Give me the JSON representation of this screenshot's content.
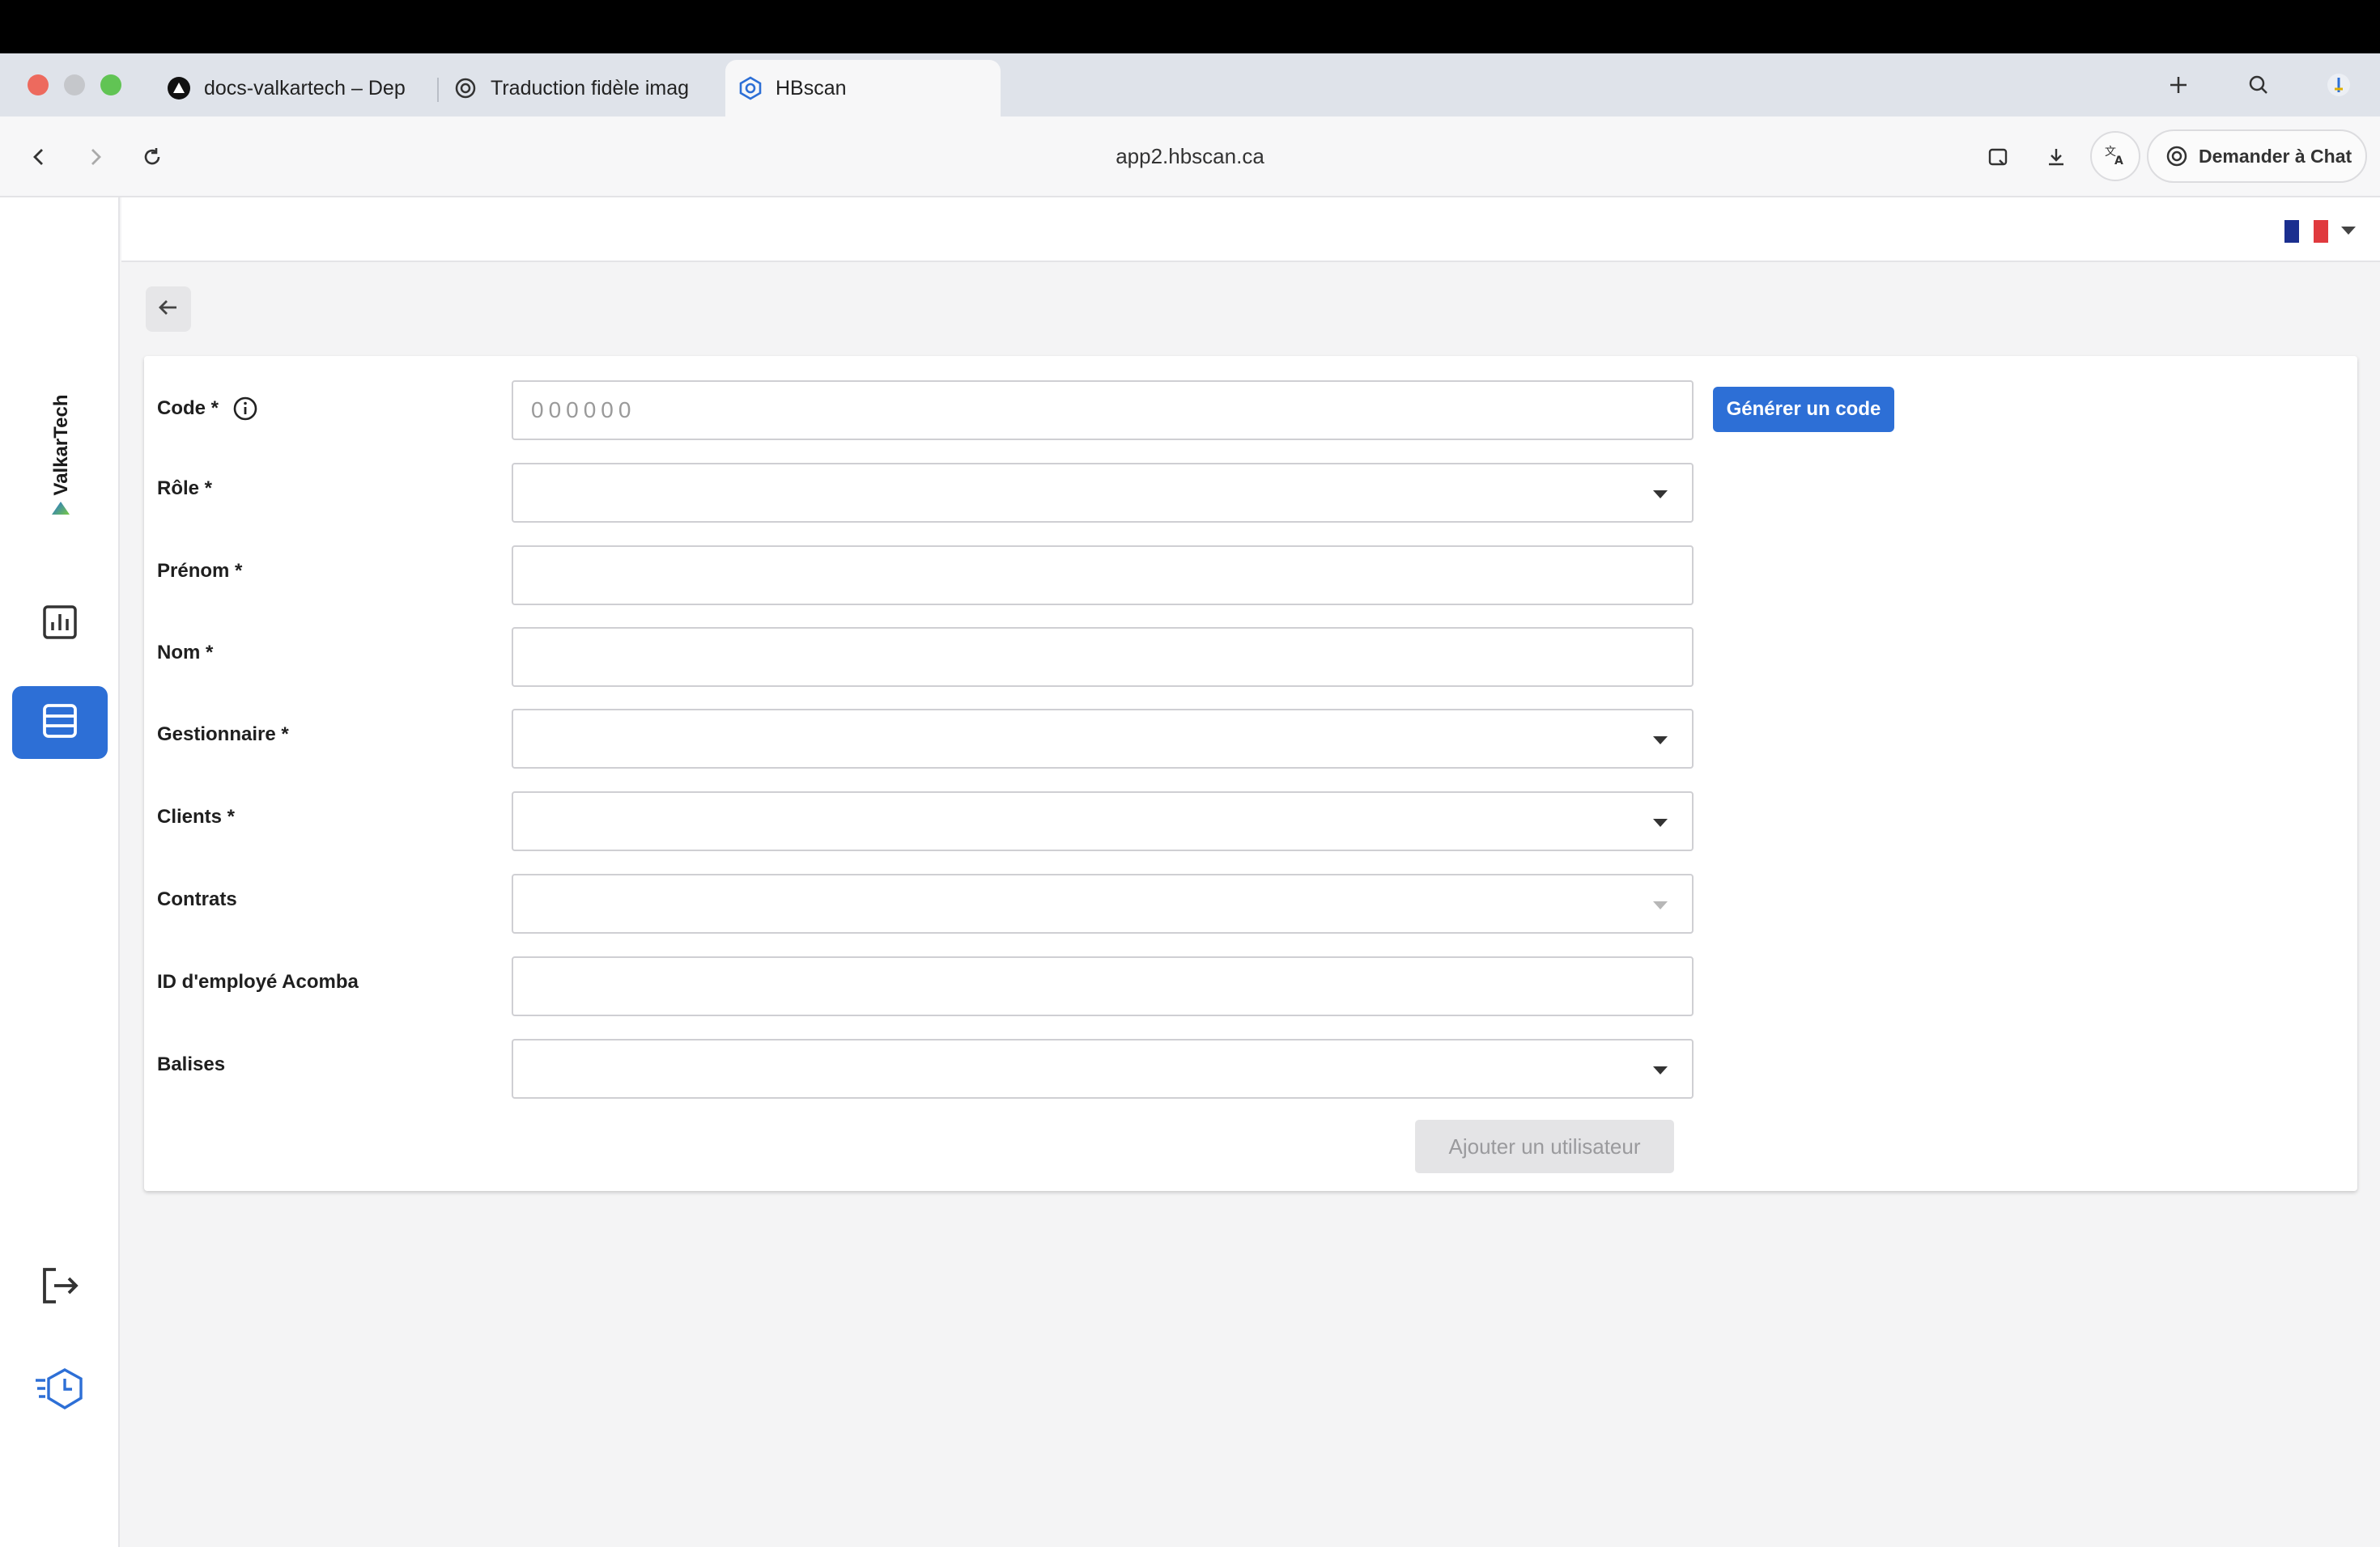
{
  "browser": {
    "tabs": [
      {
        "title": "docs-valkartech – Dep",
        "icon": "vercel-triangle-icon"
      },
      {
        "title": "Traduction fidèle imag",
        "icon": "openai-icon"
      },
      {
        "title": "HBscan",
        "icon": "hbscan-logo-icon"
      }
    ],
    "url": "app2.hbscan.ca",
    "chat_button_label": "Demander à Chat"
  },
  "sidebar": {
    "brand": "ValkarTech",
    "items": [
      {
        "name": "dashboard",
        "icon": "bar-chart-icon"
      },
      {
        "name": "list",
        "icon": "list-icon",
        "active": true
      },
      {
        "name": "logout",
        "icon": "logout-icon"
      },
      {
        "name": "timesheet",
        "icon": "clock-hexagon-icon"
      }
    ]
  },
  "header": {
    "language": "FR",
    "flag_colors": [
      "#1b2f8f",
      "#ffffff",
      "#e03a3e"
    ]
  },
  "form": {
    "fields": [
      {
        "label": "Code *",
        "type": "text",
        "placeholder": "000000",
        "value": ""
      },
      {
        "label": "Rôle *",
        "type": "select",
        "value": ""
      },
      {
        "label": "Prénom *",
        "type": "text",
        "value": ""
      },
      {
        "label": "Nom *",
        "type": "text",
        "value": ""
      },
      {
        "label": "Gestionnaire *",
        "type": "select",
        "value": ""
      },
      {
        "label": "Clients *",
        "type": "select",
        "value": ""
      },
      {
        "label": "Contrats",
        "type": "select",
        "disabled": true,
        "value": ""
      },
      {
        "label": "ID d'employé Acomba",
        "type": "text",
        "value": ""
      },
      {
        "label": "Balises",
        "type": "select",
        "value": ""
      }
    ],
    "generate_button": "Générer un code",
    "submit_button": "Ajouter un utilisateur"
  },
  "colors": {
    "accent": "#2d6fd6",
    "disabled_button_bg": "#e4e4e6"
  }
}
